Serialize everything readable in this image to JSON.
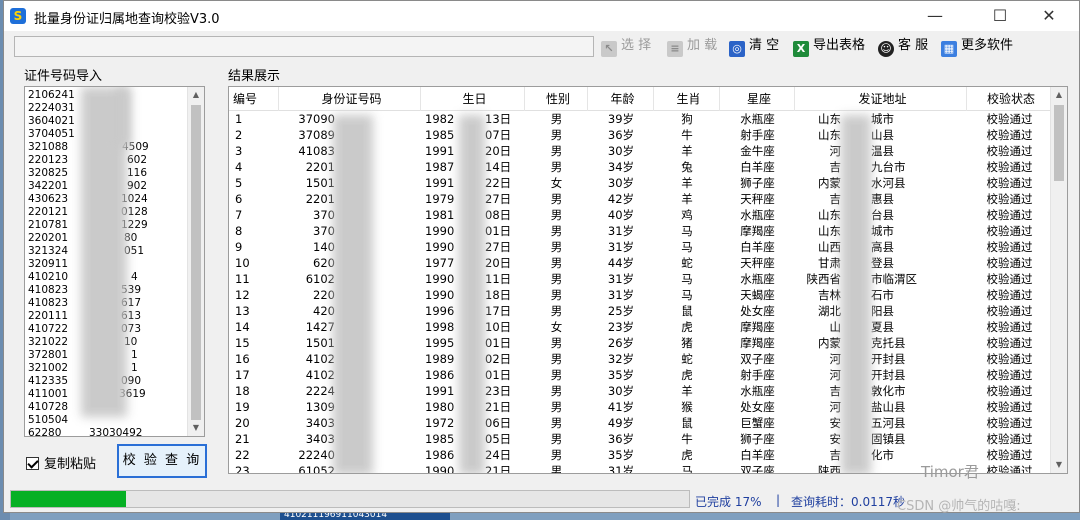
{
  "window": {
    "title": "批量身份证归属地查询校验V3.0",
    "minimize_label": "—",
    "maximize_label": "☐",
    "close_label": "✕"
  },
  "toolbar": {
    "path_value": "",
    "select_label": "选 择",
    "load_label": "加 载",
    "clear_label": "清 空",
    "export_label": "导出表格",
    "service_label": "客 服",
    "more_label": "更多软件"
  },
  "left_panel": {
    "title": "证件号码导入",
    "ids": [
      "2106241",
      "2224031",
      "3604021",
      "3704051",
      "321088",
      "220123",
      "320825",
      "342201",
      "430623",
      "220121",
      "210781",
      "220201",
      "321324",
      "320911",
      "410210",
      "410823",
      "410823",
      "220111",
      "410722",
      "321022",
      "372801",
      "321002",
      "412335",
      "411001",
      "410728",
      "510504",
      "62280"
    ],
    "id_tails": [
      "",
      "",
      "",
      "",
      "4509",
      "602",
      "116",
      "902",
      "1024",
      "0128",
      "1229",
      "80",
      "051",
      "",
      "4",
      "539",
      "617",
      "613",
      "073",
      "10",
      "1",
      "1",
      "090",
      "3619",
      "",
      "",
      "33030492"
    ],
    "copy_paste_label": "复制粘贴",
    "query_button": "校 验 查 询"
  },
  "results": {
    "title": "结果展示",
    "columns": [
      "编号",
      "身份证号码",
      "生日",
      "性别",
      "年龄",
      "生肖",
      "星座",
      "发证地址",
      "校验状态"
    ],
    "rows": [
      [
        "1",
        "37090",
        "1982",
        "13日",
        "男",
        "39岁",
        "狗",
        "水瓶座",
        "山东",
        "城市",
        "校验通过"
      ],
      [
        "2",
        "37089",
        "1985",
        "07日",
        "男",
        "36岁",
        "牛",
        "射手座",
        "山东",
        "山县",
        "校验通过"
      ],
      [
        "3",
        "41083",
        "1991",
        "20日",
        "男",
        "30岁",
        "羊",
        "金牛座",
        "河",
        "温县",
        "校验通过"
      ],
      [
        "4",
        "2201",
        "1987",
        "14日",
        "男",
        "34岁",
        "兔",
        "白羊座",
        "吉",
        "九台市",
        "校验通过"
      ],
      [
        "5",
        "1501",
        "1991",
        "22日",
        "女",
        "30岁",
        "羊",
        "狮子座",
        "内蒙",
        "水河县",
        "校验通过"
      ],
      [
        "6",
        "2201",
        "1979",
        "27日",
        "男",
        "42岁",
        "羊",
        "天秤座",
        "吉",
        "惠县",
        "校验通过"
      ],
      [
        "7",
        "370",
        "1981",
        "08日",
        "男",
        "40岁",
        "鸡",
        "水瓶座",
        "山东",
        "台县",
        "校验通过"
      ],
      [
        "8",
        "370",
        "1990",
        "01日",
        "男",
        "31岁",
        "马",
        "摩羯座",
        "山东",
        "城市",
        "校验通过"
      ],
      [
        "9",
        "140",
        "1990",
        "27日",
        "男",
        "31岁",
        "马",
        "白羊座",
        "山西",
        "高县",
        "校验通过"
      ],
      [
        "10",
        "620",
        "1977",
        "20日",
        "男",
        "44岁",
        "蛇",
        "天秤座",
        "甘肃",
        "登县",
        "校验通过"
      ],
      [
        "11",
        "6102",
        "1990",
        "11日",
        "男",
        "31岁",
        "马",
        "水瓶座",
        "陕西省",
        "市临渭区",
        "校验通过"
      ],
      [
        "12",
        "220",
        "1990",
        "18日",
        "男",
        "31岁",
        "马",
        "天蝎座",
        "吉林",
        "石市",
        "校验通过"
      ],
      [
        "13",
        "420",
        "1996",
        "17日",
        "男",
        "25岁",
        "鼠",
        "处女座",
        "湖北",
        "阳县",
        "校验通过"
      ],
      [
        "14",
        "1427",
        "1998",
        "10日",
        "女",
        "23岁",
        "虎",
        "摩羯座",
        "山",
        "夏县",
        "校验通过"
      ],
      [
        "15",
        "1501",
        "1995",
        "01日",
        "男",
        "26岁",
        "猪",
        "摩羯座",
        "内蒙",
        "克托县",
        "校验通过"
      ],
      [
        "16",
        "4102",
        "1989",
        "02日",
        "男",
        "32岁",
        "蛇",
        "双子座",
        "河",
        "开封县",
        "校验通过"
      ],
      [
        "17",
        "4102",
        "1986",
        "01日",
        "男",
        "35岁",
        "虎",
        "射手座",
        "河",
        "开封县",
        "校验通过"
      ],
      [
        "18",
        "2224",
        "1991",
        "23日",
        "男",
        "30岁",
        "羊",
        "水瓶座",
        "吉",
        "敦化市",
        "校验通过"
      ],
      [
        "19",
        "1309",
        "1980",
        "21日",
        "男",
        "41岁",
        "猴",
        "处女座",
        "河",
        "盐山县",
        "校验通过"
      ],
      [
        "20",
        "3403",
        "1972",
        "06日",
        "男",
        "49岁",
        "鼠",
        "巨蟹座",
        "安",
        "五河县",
        "校验通过"
      ],
      [
        "21",
        "3403",
        "1985",
        "05日",
        "男",
        "36岁",
        "牛",
        "狮子座",
        "安",
        "固镇县",
        "校验通过"
      ],
      [
        "22",
        "22240",
        "1986",
        "24日",
        "男",
        "35岁",
        "虎",
        "白羊座",
        "吉",
        "化市",
        "校验通过"
      ],
      [
        "23",
        "61052",
        "1990",
        "21日",
        "男",
        "31岁",
        "马",
        "双子座",
        "陕西",
        "",
        "校验通过"
      ]
    ]
  },
  "status": {
    "progress": 0.17,
    "completed": "已完成  17%",
    "separator": "|",
    "elapsed": "查询耗时：0.0117秒"
  },
  "watermarks": {
    "wechat": "Timor君",
    "csdn": "CSDN @帅气的咕嘎:"
  },
  "desktop_strip": "410211196911043014"
}
